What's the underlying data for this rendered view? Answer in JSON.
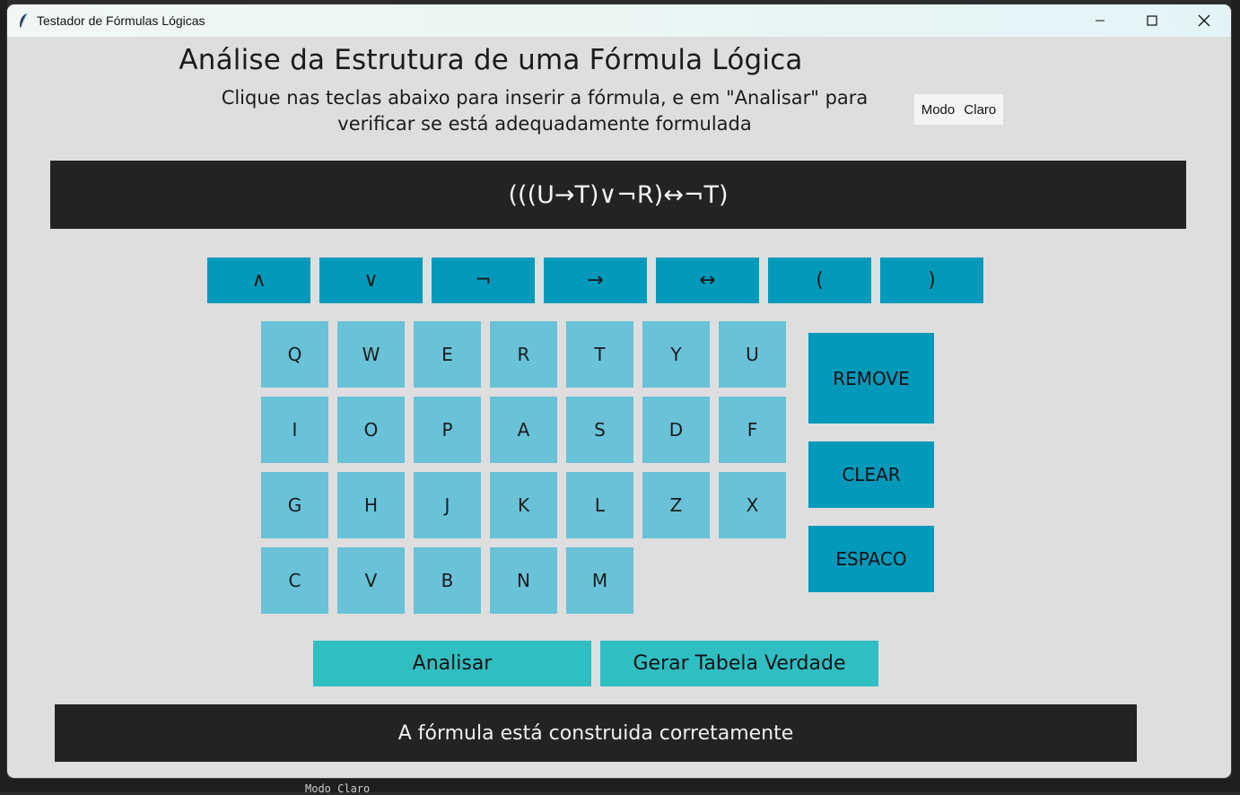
{
  "window": {
    "title": "Testador de Fórmulas Lógicas",
    "icon": "feather-icon"
  },
  "header": {
    "title": "Análise da Estrutura de uma Fórmula Lógica",
    "subtitle_line1": "Clique nas teclas abaixo para inserir a fórmula, e em \"Analisar\" para",
    "subtitle_line2": "verificar se está adequadamente formulada",
    "mode_button": "Modo Claro"
  },
  "formula": "(((U→T)∨¬R)↔¬T)",
  "operators": [
    "∧",
    "∨",
    "¬",
    "→",
    "↔",
    "(",
    ")"
  ],
  "keyboard": {
    "row1": [
      "Q",
      "W",
      "E",
      "R",
      "T",
      "Y",
      "U"
    ],
    "row2": [
      "I",
      "O",
      "P",
      "A",
      "S",
      "D",
      "F"
    ],
    "row3": [
      "G",
      "H",
      "J",
      "K",
      "L",
      "Z",
      "X"
    ],
    "row4": [
      "C",
      "V",
      "B",
      "N",
      "M"
    ]
  },
  "actions": {
    "remove": "REMOVE",
    "clear": "CLEAR",
    "space": "ESPACO"
  },
  "buttons": {
    "analyze": "Analisar",
    "truth_table": "Gerar Tabela Verdade"
  },
  "result": "A fórmula está construida corretamente",
  "background": {
    "bottom_text": "Modo Claro"
  },
  "colors": {
    "window_bg": "#dedede",
    "display_bg": "#232323",
    "operator_bg": "#0399bb",
    "key_bg": "#69c2d8",
    "main_button_bg": "#30bec2"
  }
}
